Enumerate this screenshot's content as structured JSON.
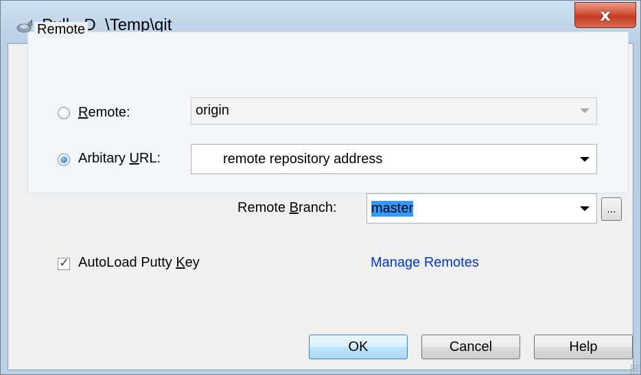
{
  "window": {
    "title": "Pull - D_\\Temp\\git",
    "close_glyph": "x",
    "accent_close": "#c23a24"
  },
  "group": {
    "legend": "Remote",
    "remote_radio": {
      "label_pre": "",
      "label_u": "R",
      "label_post": "emote:",
      "checked": false
    },
    "remote_combo": {
      "value": "origin",
      "enabled": false
    },
    "url_radio": {
      "label_pre": "Arbitary ",
      "label_u": "U",
      "label_post": "RL:",
      "checked": true
    },
    "url_combo": {
      "value": "remote repository address"
    },
    "branch": {
      "label_pre": "Remote ",
      "label_u": "B",
      "label_post": "ranch:",
      "value": "master",
      "browse_label": "..."
    }
  },
  "options": {
    "autoload": {
      "label_pre": "AutoLoad Putty ",
      "label_u": "K",
      "label_post": "ey",
      "checked": true
    },
    "manage_link": "Manage Remotes"
  },
  "buttons": {
    "ok": "OK",
    "cancel": "Cancel",
    "help": "Help"
  }
}
